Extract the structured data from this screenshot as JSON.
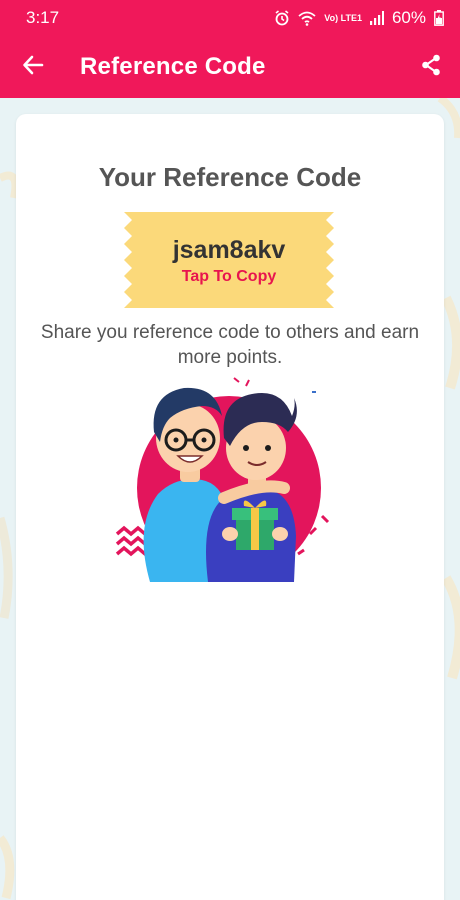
{
  "status_bar": {
    "time": "3:17",
    "battery_percent": "60%",
    "network_label": "Vo) LTE1",
    "icons": [
      "alarm-icon",
      "wifi-icon",
      "volte-icon",
      "signal-icon",
      "battery-icon"
    ]
  },
  "app_bar": {
    "title": "Reference Code",
    "back_icon": "arrow-left-icon",
    "share_icon": "share-icon"
  },
  "card": {
    "title": "Your Reference Code",
    "code": "jsam8akv",
    "copy_label": "Tap To Copy",
    "description": "Share you reference code to others and earn more points."
  },
  "colors": {
    "primary": "#f0185a",
    "ticket": "#fbd97a",
    "copy_text": "#e8154e",
    "text": "#555555",
    "background": "#e8f3f5"
  }
}
